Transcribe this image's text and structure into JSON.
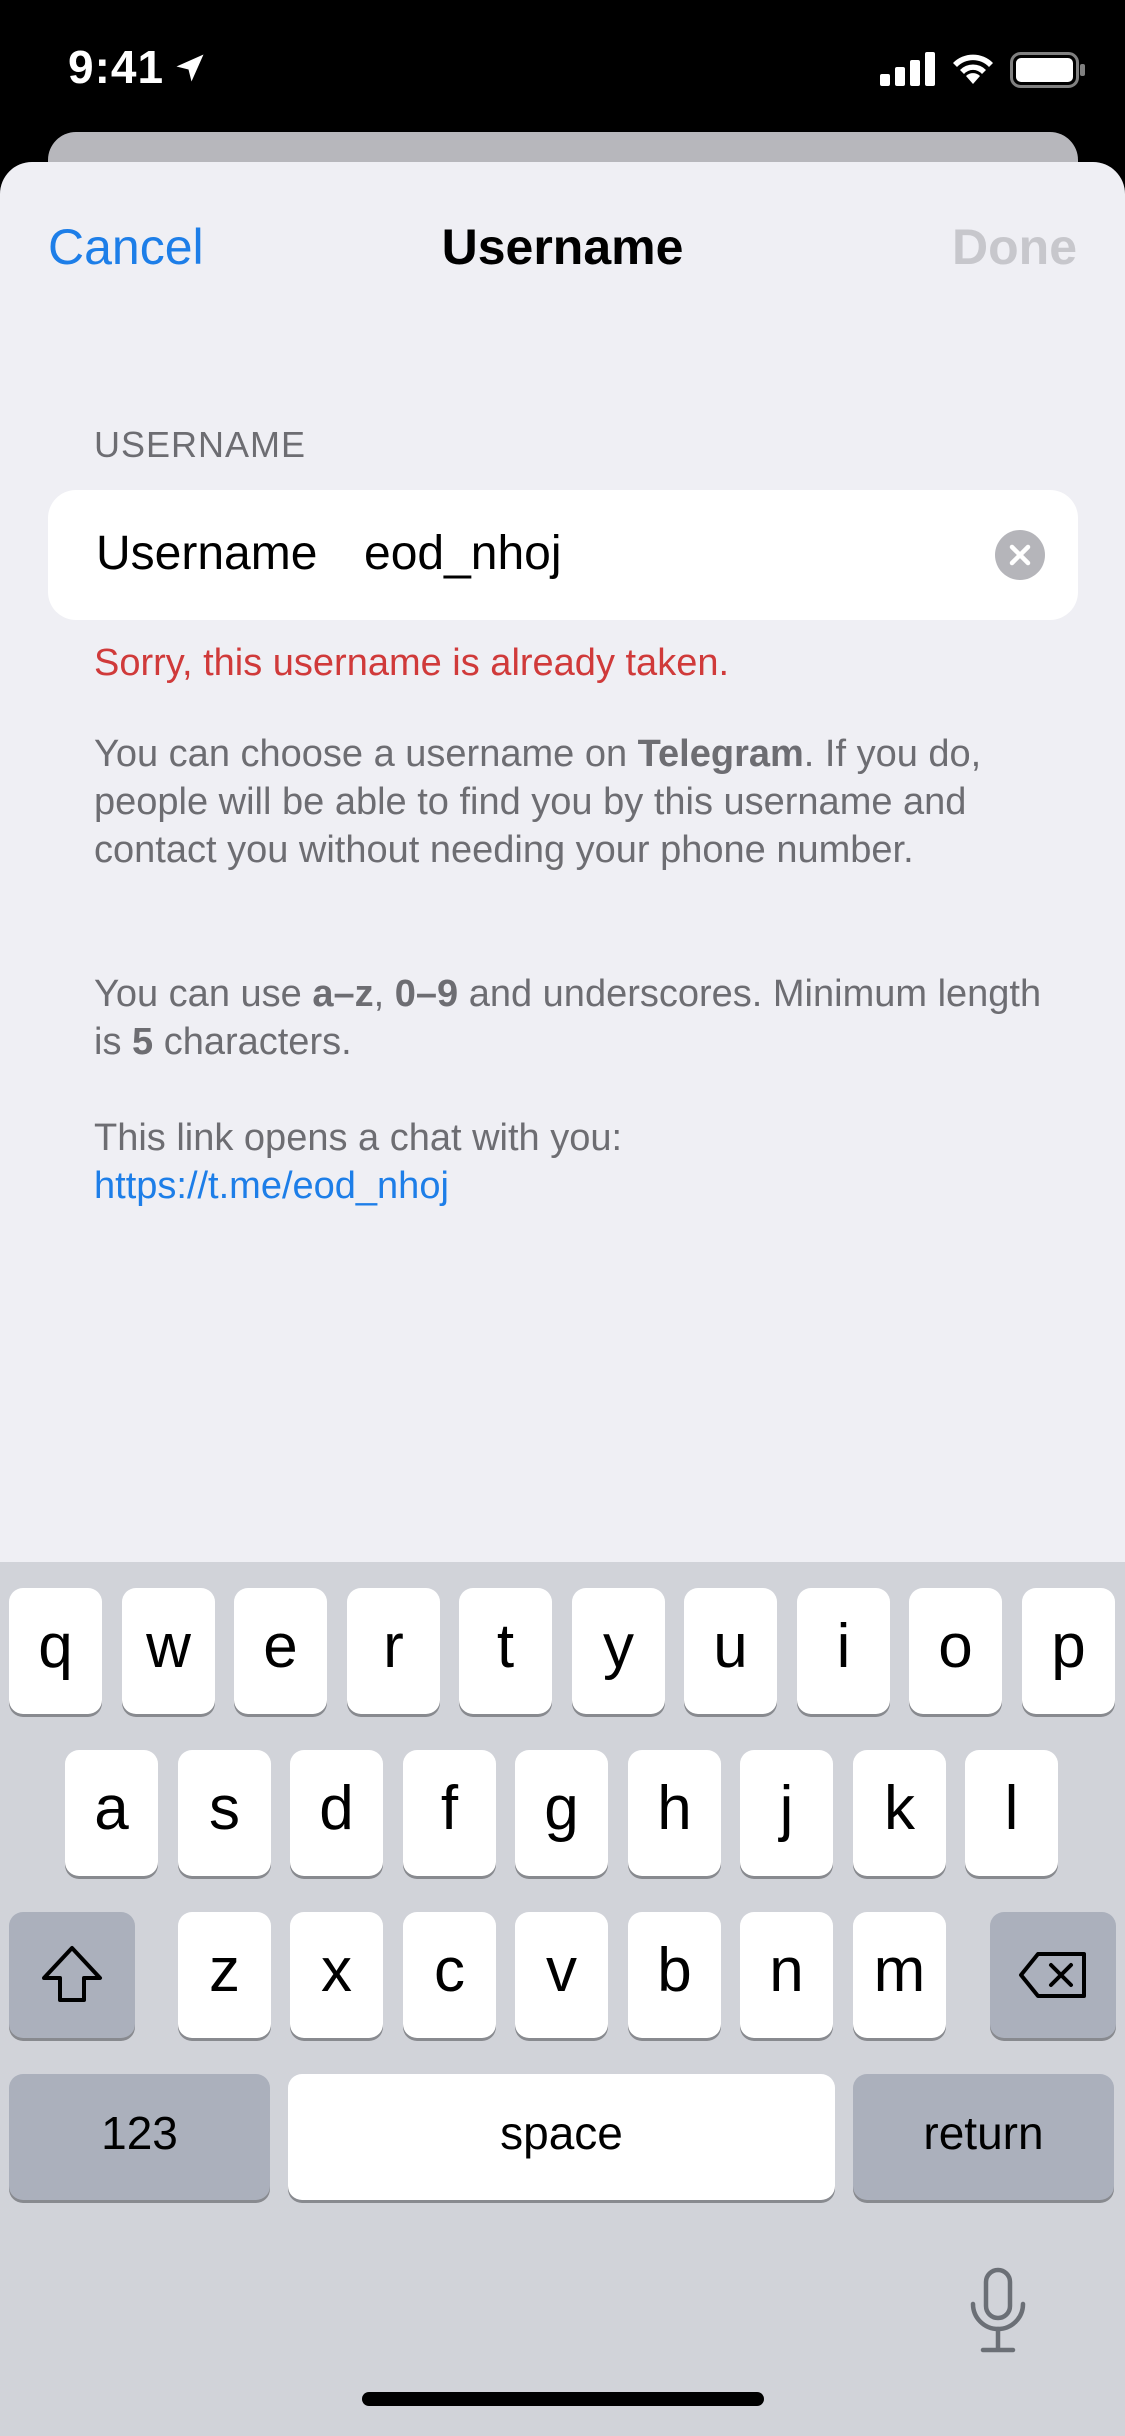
{
  "status_bar": {
    "time": "9:41"
  },
  "nav": {
    "cancel": "Cancel",
    "title": "Username",
    "done": "Done"
  },
  "section_header": "USERNAME",
  "field": {
    "label": "Username",
    "value": "eod_nhoj"
  },
  "error": "Sorry, this username is already taken.",
  "info": {
    "p1_a": "You can choose a username on ",
    "p1_bold": "Telegram",
    "p1_b": ". If you do, people will be able to find you by this username and contact you without needing your phone number.",
    "p2_a": "You can use ",
    "p2_b1": "a–z",
    "p2_c": ", ",
    "p2_b2": "0–9",
    "p2_d": " and underscores. Minimum length is ",
    "p2_b3": "5",
    "p2_e": " characters.",
    "p3_text": "This link opens a chat with you:",
    "p3_link": "https://t.me/eod_nhoj"
  },
  "keyboard": {
    "row1": [
      "q",
      "w",
      "e",
      "r",
      "t",
      "y",
      "u",
      "i",
      "o",
      "p"
    ],
    "row2": [
      "a",
      "s",
      "d",
      "f",
      "g",
      "h",
      "j",
      "k",
      "l"
    ],
    "row3": [
      "z",
      "x",
      "c",
      "v",
      "b",
      "n",
      "m"
    ],
    "numbers": "123",
    "space": "space",
    "return": "return"
  },
  "colors": {
    "accent": "#1d7ee8",
    "error": "#d03a3a",
    "background": "#efeff4"
  }
}
